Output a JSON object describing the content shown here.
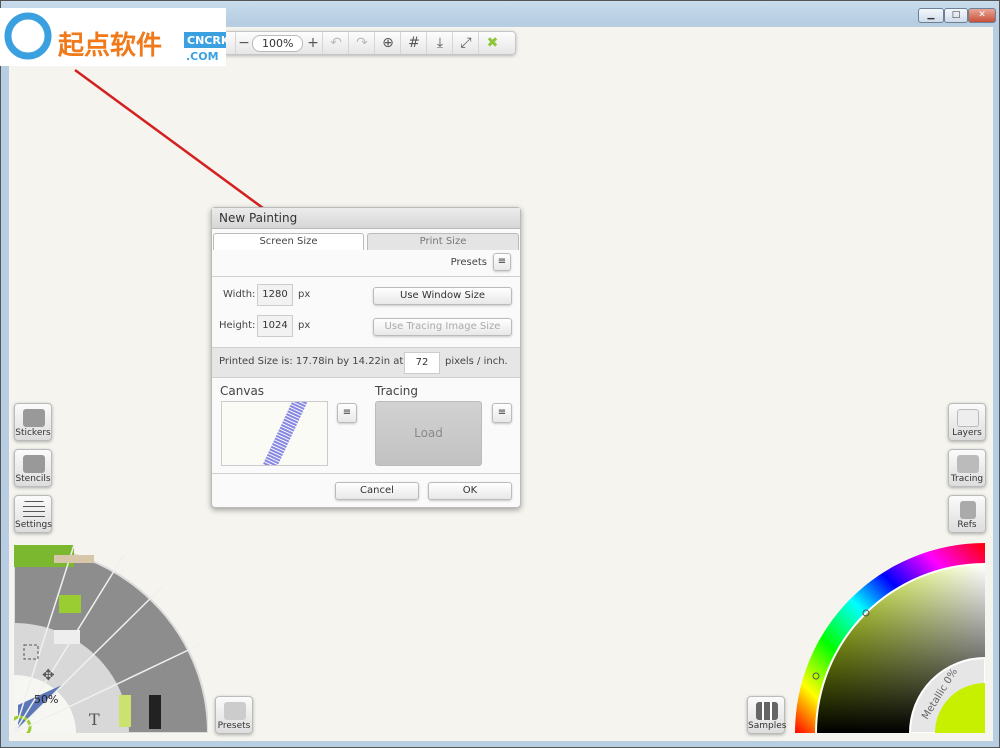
{
  "watermark": {
    "text": "起点软件",
    "domain1": "CNCRK",
    "domain2": ".COM"
  },
  "window": {
    "controls": [
      "minimize",
      "maximize",
      "close"
    ]
  },
  "toolbar": {
    "minus": "−",
    "zoom": "100%",
    "plus": "+"
  },
  "dialog": {
    "title": "New Painting",
    "tabs": [
      "Screen Size",
      "Print Size"
    ],
    "presets_label": "Presets",
    "width_label": "Width:",
    "width_value": "1280",
    "height_label": "Height:",
    "height_value": "1024",
    "unit": "px",
    "use_window_size": "Use Window Size",
    "use_tracing_size": "Use Tracing Image Size",
    "printed_size_text": "Printed Size is: 17.78in by 14.22in at:",
    "dpi_value": "72",
    "dpi_unit": "pixels / inch.",
    "canvas_label": "Canvas",
    "tracing_label": "Tracing",
    "load_label": "Load",
    "cancel": "Cancel",
    "ok": "OK"
  },
  "left_panel": {
    "stickers": "Stickers",
    "stencils": "Stencils",
    "settings": "Settings",
    "presets": "Presets",
    "tool_size": "50%",
    "text_tool": "T"
  },
  "right_panel": {
    "layers": "Layers",
    "tracing": "Tracing",
    "refs": "Refs",
    "samples": "Samples",
    "metallic": "Metallic 0%"
  },
  "colors": {
    "accent": "#9acd32",
    "arrow": "#d42020"
  }
}
